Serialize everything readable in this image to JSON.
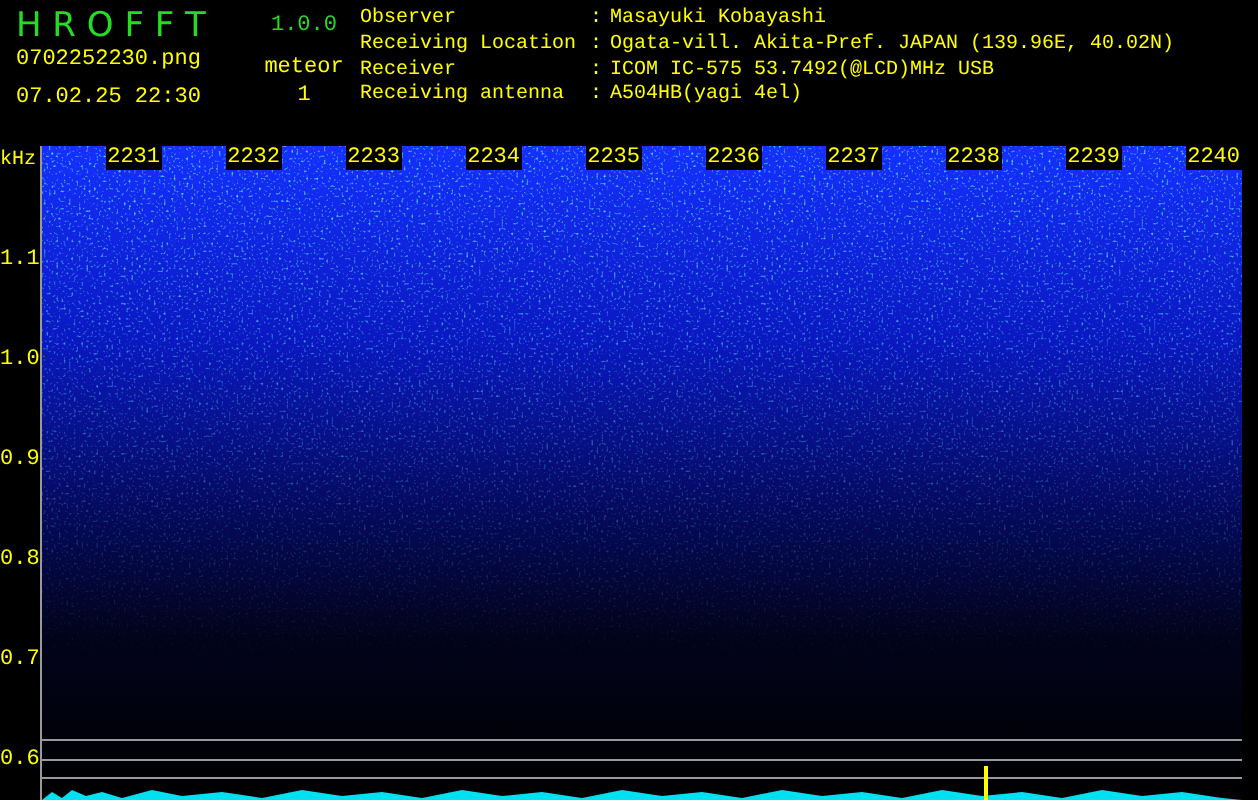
{
  "app": {
    "name": "H R O F F T",
    "version": "1.0.0",
    "file": "0702252230.png",
    "datetime": "07.02.25 22:30"
  },
  "counter": {
    "label": "meteor",
    "value": "1"
  },
  "info": [
    {
      "label": "Observer",
      "separator": ":",
      "value": "Masayuki Kobayashi"
    },
    {
      "label": "Receiving Location",
      "separator": ":",
      "value": "Ogata-vill. Akita-Pref. JAPAN (139.96E, 40.02N)"
    },
    {
      "label": "Receiver",
      "separator": ":",
      "value": "ICOM IC-575 53.7492(@LCD)MHz USB"
    },
    {
      "label": "Receiving antenna",
      "separator": ":",
      "value": "A504HB(yagi 4el)"
    }
  ],
  "spectrogram": {
    "y_unit": "kHz",
    "y_labels": [
      "1.1",
      "1.0",
      "0.9",
      "0.8",
      "0.7",
      "0.6"
    ],
    "time_labels": [
      "2231",
      "2232",
      "2233",
      "2234",
      "2235",
      "2236",
      "2237",
      "2238",
      "2239",
      "2240"
    ]
  }
}
